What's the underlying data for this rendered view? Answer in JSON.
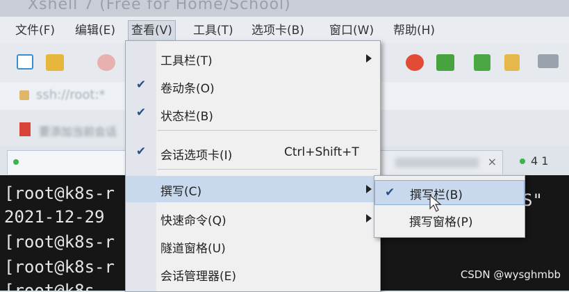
{
  "window": {
    "title": "Xshell 7 (Free for Home/School)"
  },
  "menubar": {
    "items": [
      {
        "label": "文件(F)",
        "active": false
      },
      {
        "label": "编辑(E)",
        "active": false
      },
      {
        "label": "查看(V)",
        "active": true
      },
      {
        "label": "工具(T)",
        "active": false
      },
      {
        "label": "选项卡(B)",
        "active": false
      },
      {
        "label": "窗口(W)",
        "active": false
      },
      {
        "label": "帮助(H)",
        "active": false
      }
    ]
  },
  "address": {
    "value": "ssh://root:*"
  },
  "bookmarks": {
    "label": "要添加当前会话"
  },
  "view_menu": {
    "items": [
      {
        "label": "工具栏(T)",
        "checked": false,
        "submenu": true
      },
      {
        "label": "卷动条(O)",
        "checked": true,
        "submenu": false
      },
      {
        "label": "状态栏(B)",
        "checked": true,
        "submenu": false
      },
      {
        "label": "会话选项卡(I)",
        "checked": true,
        "shortcut": "Ctrl+Shift+T",
        "submenu": false
      },
      {
        "label": "撰写(C)",
        "checked": false,
        "submenu": true,
        "highlighted": true
      },
      {
        "label": "快速命令(Q)",
        "checked": false,
        "submenu": true
      },
      {
        "label": "隧道窗格(U)",
        "checked": false,
        "submenu": false
      },
      {
        "label": "会话管理器(E)",
        "checked": false,
        "submenu": false
      }
    ]
  },
  "compose_submenu": {
    "items": [
      {
        "label": "撰写栏(B)",
        "checked": true,
        "highlighted": true
      },
      {
        "label": "撰写窗格(P)",
        "checked": false
      }
    ]
  },
  "tabs": {
    "right_tab_counter": "4 1"
  },
  "terminal": {
    "lines": [
      "[root@k8s-r",
      "2021-12-29",
      "[root@k8s-r",
      "[root@k8s-r",
      "[root@k8s-"
    ],
    "right_text": "S\""
  },
  "watermark": "CSDN @wysghmbb",
  "colors": {
    "menu_highlight": "#c8d9ee",
    "terminal_bg": "#161616",
    "check": "#2c4f86"
  }
}
